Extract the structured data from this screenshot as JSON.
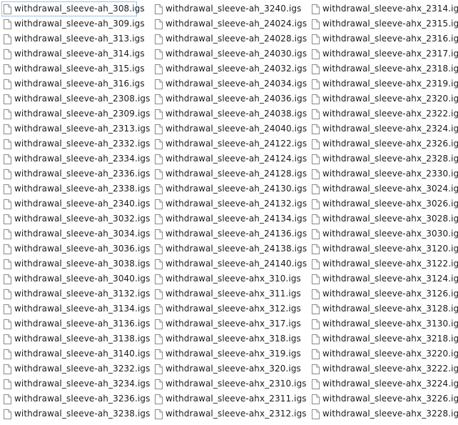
{
  "file_list": {
    "columns": [
      {
        "items": [
          {
            "name": "withdrawal_sleeve-ah_308.igs",
            "focused": true
          },
          {
            "name": "withdrawal_sleeve-ah_309.igs"
          },
          {
            "name": "withdrawal_sleeve-ah_313.igs"
          },
          {
            "name": "withdrawal_sleeve-ah_314.igs"
          },
          {
            "name": "withdrawal_sleeve-ah_315.igs"
          },
          {
            "name": "withdrawal_sleeve-ah_316.igs"
          },
          {
            "name": "withdrawal_sleeve-ah_2308.igs"
          },
          {
            "name": "withdrawal_sleeve-ah_2309.igs"
          },
          {
            "name": "withdrawal_sleeve-ah_2313.igs"
          },
          {
            "name": "withdrawal_sleeve-ah_2332.igs"
          },
          {
            "name": "withdrawal_sleeve-ah_2334.igs"
          },
          {
            "name": "withdrawal_sleeve-ah_2336.igs"
          },
          {
            "name": "withdrawal_sleeve-ah_2338.igs"
          },
          {
            "name": "withdrawal_sleeve-ah_2340.igs"
          },
          {
            "name": "withdrawal_sleeve-ah_3032.igs"
          },
          {
            "name": "withdrawal_sleeve-ah_3034.igs"
          },
          {
            "name": "withdrawal_sleeve-ah_3036.igs"
          },
          {
            "name": "withdrawal_sleeve-ah_3038.igs"
          },
          {
            "name": "withdrawal_sleeve-ah_3040.igs"
          },
          {
            "name": "withdrawal_sleeve-ah_3132.igs"
          },
          {
            "name": "withdrawal_sleeve-ah_3134.igs"
          },
          {
            "name": "withdrawal_sleeve-ah_3136.igs"
          },
          {
            "name": "withdrawal_sleeve-ah_3138.igs"
          },
          {
            "name": "withdrawal_sleeve-ah_3140.igs"
          },
          {
            "name": "withdrawal_sleeve-ah_3232.igs"
          },
          {
            "name": "withdrawal_sleeve-ah_3234.igs"
          },
          {
            "name": "withdrawal_sleeve-ah_3236.igs"
          },
          {
            "name": "withdrawal_sleeve-ah_3238.igs"
          }
        ]
      },
      {
        "items": [
          {
            "name": "withdrawal_sleeve-ah_3240.igs"
          },
          {
            "name": "withdrawal_sleeve-ah_24024.igs"
          },
          {
            "name": "withdrawal_sleeve-ah_24028.igs"
          },
          {
            "name": "withdrawal_sleeve-ah_24030.igs"
          },
          {
            "name": "withdrawal_sleeve-ah_24032.igs"
          },
          {
            "name": "withdrawal_sleeve-ah_24034.igs"
          },
          {
            "name": "withdrawal_sleeve-ah_24036.igs"
          },
          {
            "name": "withdrawal_sleeve-ah_24038.igs"
          },
          {
            "name": "withdrawal_sleeve-ah_24040.igs"
          },
          {
            "name": "withdrawal_sleeve-ah_24122.igs"
          },
          {
            "name": "withdrawal_sleeve-ah_24124.igs"
          },
          {
            "name": "withdrawal_sleeve-ah_24128.igs"
          },
          {
            "name": "withdrawal_sleeve-ah_24130.igs"
          },
          {
            "name": "withdrawal_sleeve-ah_24132.igs"
          },
          {
            "name": "withdrawal_sleeve-ah_24134.igs"
          },
          {
            "name": "withdrawal_sleeve-ah_24136.igs"
          },
          {
            "name": "withdrawal_sleeve-ah_24138.igs"
          },
          {
            "name": "withdrawal_sleeve-ah_24140.igs"
          },
          {
            "name": "withdrawal_sleeve-ahx_310.igs"
          },
          {
            "name": "withdrawal_sleeve-ahx_311.igs"
          },
          {
            "name": "withdrawal_sleeve-ahx_312.igs"
          },
          {
            "name": "withdrawal_sleeve-ahx_317.igs"
          },
          {
            "name": "withdrawal_sleeve-ahx_318.igs"
          },
          {
            "name": "withdrawal_sleeve-ahx_319.igs"
          },
          {
            "name": "withdrawal_sleeve-ahx_320.igs"
          },
          {
            "name": "withdrawal_sleeve-ahx_2310.igs"
          },
          {
            "name": "withdrawal_sleeve-ahx_2311.igs"
          },
          {
            "name": "withdrawal_sleeve-ahx_2312.igs"
          }
        ]
      },
      {
        "items": [
          {
            "name": "withdrawal_sleeve-ahx_2314.igs"
          },
          {
            "name": "withdrawal_sleeve-ahx_2315.igs"
          },
          {
            "name": "withdrawal_sleeve-ahx_2316.igs"
          },
          {
            "name": "withdrawal_sleeve-ahx_2317.igs"
          },
          {
            "name": "withdrawal_sleeve-ahx_2318.igs"
          },
          {
            "name": "withdrawal_sleeve-ahx_2319.igs"
          },
          {
            "name": "withdrawal_sleeve-ahx_2320.igs"
          },
          {
            "name": "withdrawal_sleeve-ahx_2322.igs"
          },
          {
            "name": "withdrawal_sleeve-ahx_2324.igs"
          },
          {
            "name": "withdrawal_sleeve-ahx_2326.igs"
          },
          {
            "name": "withdrawal_sleeve-ahx_2328.igs"
          },
          {
            "name": "withdrawal_sleeve-ahx_2330.igs"
          },
          {
            "name": "withdrawal_sleeve-ahx_3024.igs"
          },
          {
            "name": "withdrawal_sleeve-ahx_3026.igs"
          },
          {
            "name": "withdrawal_sleeve-ahx_3028.igs"
          },
          {
            "name": "withdrawal_sleeve-ahx_3030.igs"
          },
          {
            "name": "withdrawal_sleeve-ahx_3120.igs"
          },
          {
            "name": "withdrawal_sleeve-ahx_3122.igs"
          },
          {
            "name": "withdrawal_sleeve-ahx_3124.igs"
          },
          {
            "name": "withdrawal_sleeve-ahx_3126.igs"
          },
          {
            "name": "withdrawal_sleeve-ahx_3128.igs"
          },
          {
            "name": "withdrawal_sleeve-ahx_3130.igs"
          },
          {
            "name": "withdrawal_sleeve-ahx_3218.igs"
          },
          {
            "name": "withdrawal_sleeve-ahx_3220.igs"
          },
          {
            "name": "withdrawal_sleeve-ahx_3222.igs"
          },
          {
            "name": "withdrawal_sleeve-ahx_3224.igs"
          },
          {
            "name": "withdrawal_sleeve-ahx_3226.igs"
          },
          {
            "name": "withdrawal_sleeve-ahx_3228.igs"
          }
        ]
      }
    ],
    "icon": "blank-document-icon",
    "colors": {
      "focus_border": "#9dc3e6",
      "text": "#1a1a1a",
      "background": "#ffffff"
    }
  }
}
